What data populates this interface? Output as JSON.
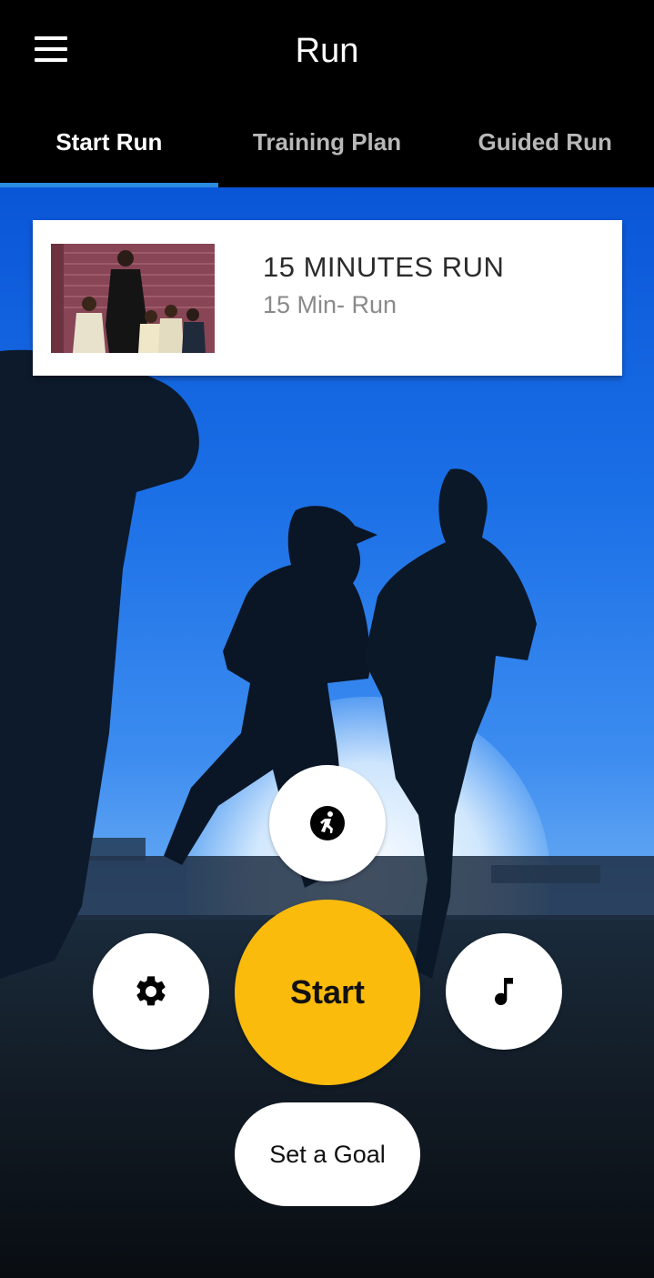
{
  "app_bar": {
    "title": "Run",
    "menu_icon": "hamburger-menu-icon"
  },
  "tabs": [
    {
      "label": "Start Run",
      "active": true
    },
    {
      "label": "Training Plan",
      "active": false
    },
    {
      "label": "Guided Run",
      "active": false
    }
  ],
  "program_card": {
    "title": "15 MINUTES RUN",
    "subtitle": "15 Min- Run",
    "thumbnail": "coach-and-athletes-photo"
  },
  "controls": {
    "activity_icon": "running-person-icon",
    "settings_icon": "gear-icon",
    "music_icon": "music-note-icon",
    "start_label": "Start",
    "goal_label": "Set a Goal"
  },
  "colors": {
    "accent_tab_indicator": "#2a8be0",
    "start_button": "#fbbb0c",
    "app_bar": "#000000"
  }
}
